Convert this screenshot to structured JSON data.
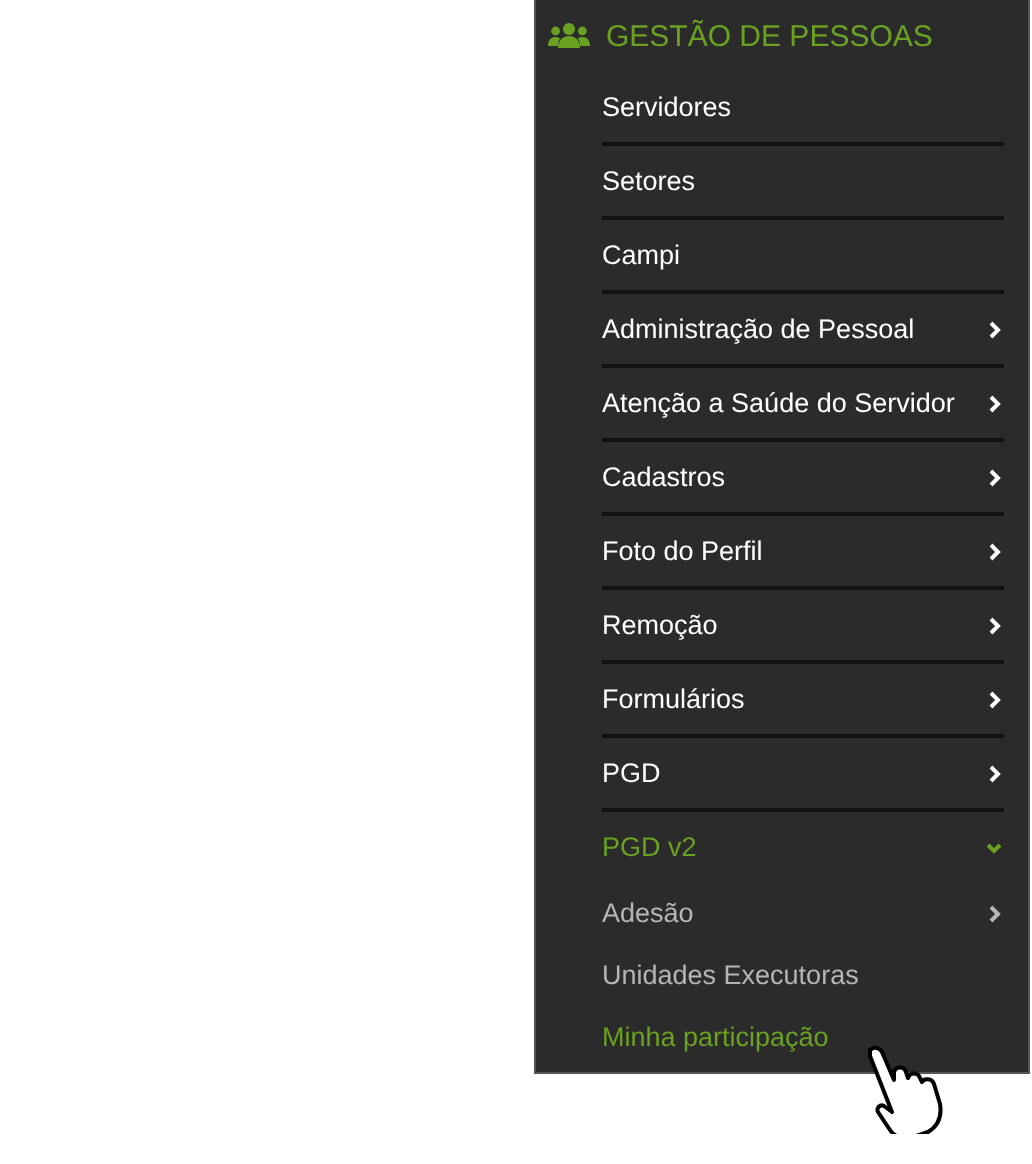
{
  "section": {
    "title": "GESTÃO DE PESSOAS"
  },
  "items": [
    {
      "label": "Servidores",
      "has_submenu": false
    },
    {
      "label": "Setores",
      "has_submenu": false
    },
    {
      "label": "Campi",
      "has_submenu": false
    },
    {
      "label": "Administração de Pessoal",
      "has_submenu": true
    },
    {
      "label": "Atenção a Saúde do Servidor",
      "has_submenu": true
    },
    {
      "label": "Cadastros",
      "has_submenu": true
    },
    {
      "label": "Foto do Perfil",
      "has_submenu": true
    },
    {
      "label": "Remoção",
      "has_submenu": true
    },
    {
      "label": "Formulários",
      "has_submenu": true
    },
    {
      "label": "PGD",
      "has_submenu": true
    },
    {
      "label": "PGD v2",
      "has_submenu": true,
      "expanded": true,
      "children": [
        {
          "label": "Adesão",
          "has_submenu": true,
          "selected": false
        },
        {
          "label": "Unidades Executoras",
          "has_submenu": false,
          "selected": false
        },
        {
          "label": "Minha participação",
          "has_submenu": false,
          "selected": true
        }
      ]
    }
  ]
}
